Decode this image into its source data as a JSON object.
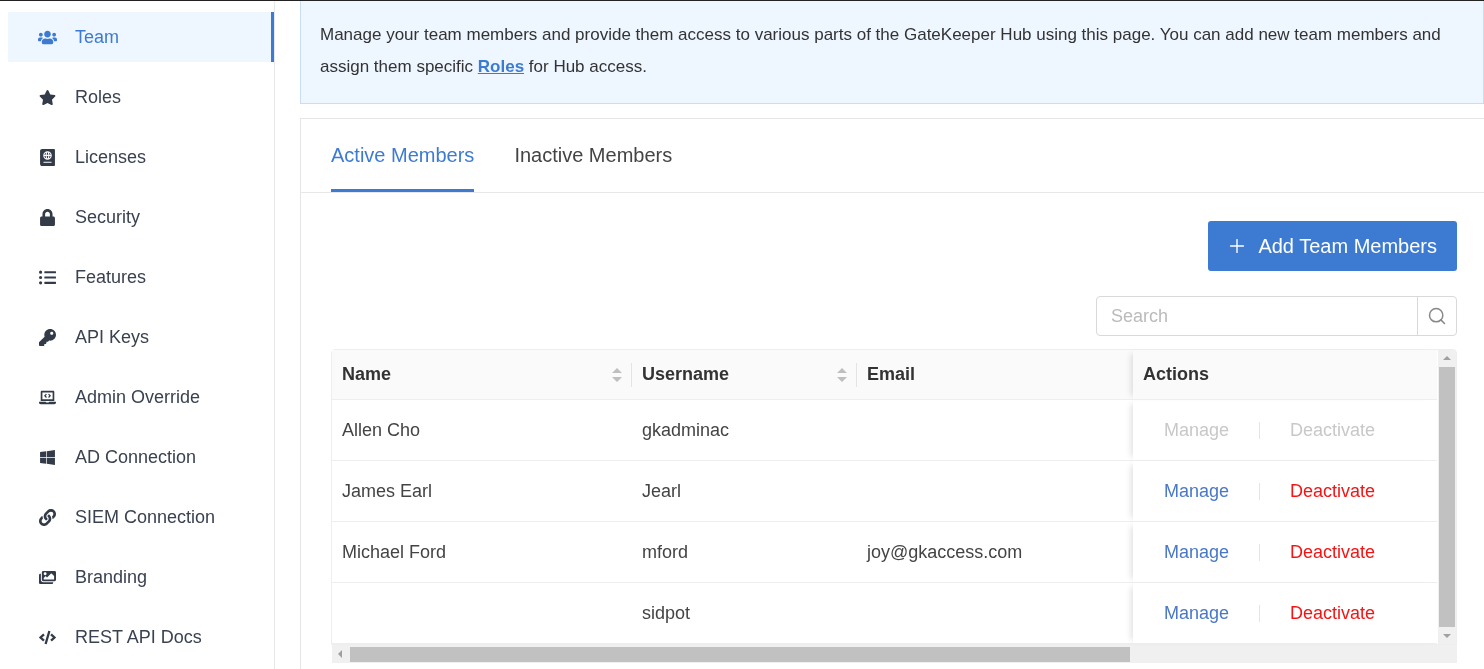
{
  "sidebar": {
    "items": [
      {
        "label": "Team",
        "selected": true
      },
      {
        "label": "Roles",
        "selected": false
      },
      {
        "label": "Licenses",
        "selected": false
      },
      {
        "label": "Security",
        "selected": false
      },
      {
        "label": "Features",
        "selected": false
      },
      {
        "label": "API Keys",
        "selected": false
      },
      {
        "label": "Admin Override",
        "selected": false
      },
      {
        "label": "AD Connection",
        "selected": false
      },
      {
        "label": "SIEM Connection",
        "selected": false
      },
      {
        "label": "Branding",
        "selected": false
      },
      {
        "label": "REST API Docs",
        "selected": false
      }
    ]
  },
  "info": {
    "text_before": "Manage your team members and provide them access to various parts of the GateKeeper Hub using this page. You can add new team members and assign them specific ",
    "link": "Roles",
    "text_after": " for Hub access."
  },
  "tabs": [
    {
      "label": "Active Members",
      "selected": true
    },
    {
      "label": "Inactive Members",
      "selected": false
    }
  ],
  "add_button": "Add Team Members",
  "search": {
    "placeholder": "Search"
  },
  "table": {
    "columns": [
      {
        "label": "Name",
        "sortable": true
      },
      {
        "label": "Username",
        "sortable": true
      },
      {
        "label": "Email",
        "sortable": false
      },
      {
        "label": "Actions",
        "sortable": false
      }
    ],
    "rows": [
      {
        "name": "Allen Cho",
        "username": "gkadminac",
        "email": "",
        "manage": "Manage",
        "deactivate": "Deactivate",
        "disabled": true
      },
      {
        "name": "James Earl",
        "username": "Jearl",
        "email": "",
        "manage": "Manage",
        "deactivate": "Deactivate",
        "disabled": false
      },
      {
        "name": "Michael Ford",
        "username": "mford",
        "email": "joy@gkaccess.com",
        "manage": "Manage",
        "deactivate": "Deactivate",
        "disabled": false
      },
      {
        "name": "",
        "username": "sidpot",
        "email": "",
        "manage": "Manage",
        "deactivate": "Deactivate",
        "disabled": false
      }
    ]
  }
}
